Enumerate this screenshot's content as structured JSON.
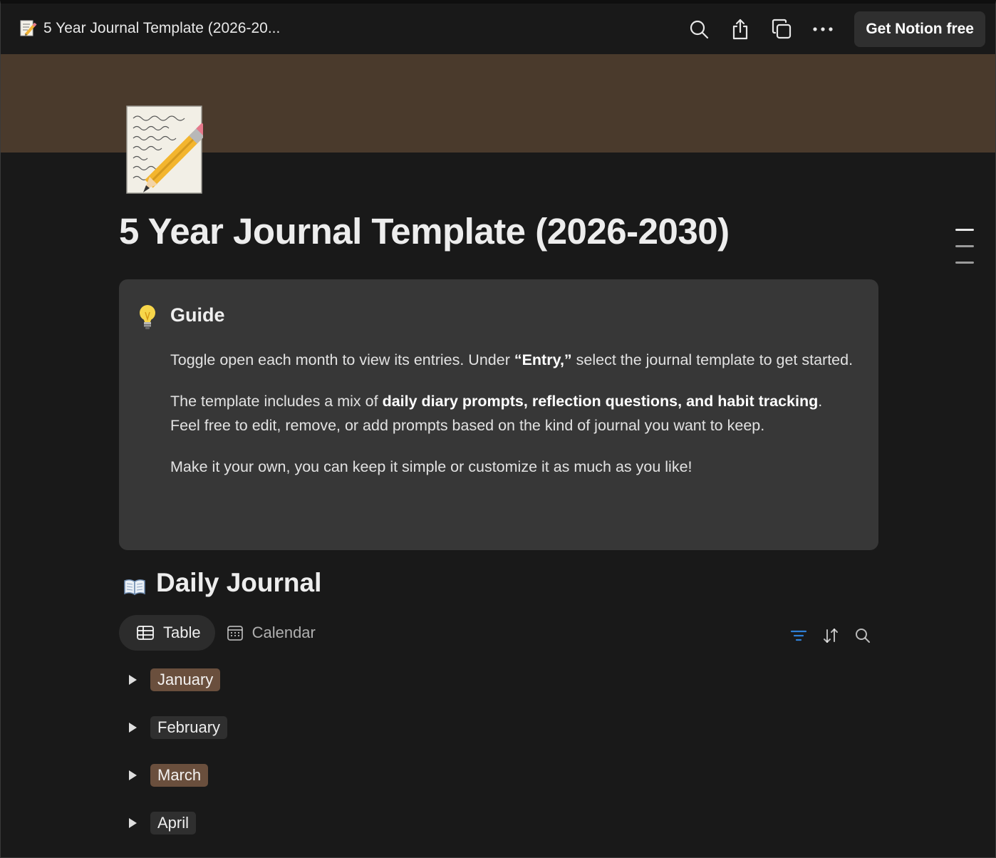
{
  "topbar": {
    "title": "5 Year Journal Template (2026-20...",
    "title_icon": "memo-icon",
    "actions": [
      "search-icon",
      "share-icon",
      "duplicate-icon",
      "more-icon"
    ],
    "cta_label": "Get Notion free"
  },
  "page": {
    "cover_color": "#4a3a2c",
    "icon": "memo-icon",
    "title": "5 Year Journal Template (2026-2030)"
  },
  "callout": {
    "icon": "lightbulb-icon",
    "heading": "Guide",
    "p1_a": "Toggle open each month to view its entries. Under ",
    "p1_b": "“Entry,”",
    "p1_c": " select the journal template to get started.",
    "p2_a": "The template includes a mix of ",
    "p2_b": "daily diary prompts, reflection questions, and habit tracking",
    "p2_c": ". Feel free to edit, remove, or add prompts based on the kind of journal you want to keep.",
    "p3": "Make it your own, you can keep it simple or customize it as much as you like!"
  },
  "database": {
    "icon": "open-book-icon",
    "title": "Daily Journal",
    "views": [
      {
        "label": "Table",
        "icon": "table-icon",
        "active": true
      },
      {
        "label": "Calendar",
        "icon": "calendar-icon",
        "active": false
      }
    ],
    "actions": [
      "filter-icon",
      "sort-icon",
      "search-icon"
    ],
    "filter_color": "#2f7fd6",
    "groups": [
      {
        "label": "January",
        "color": "#6a4f3d"
      },
      {
        "label": "February",
        "color": "#2f2f2f"
      },
      {
        "label": "March",
        "color": "#6a4f3d"
      },
      {
        "label": "April",
        "color": "#2f2f2f"
      }
    ]
  }
}
